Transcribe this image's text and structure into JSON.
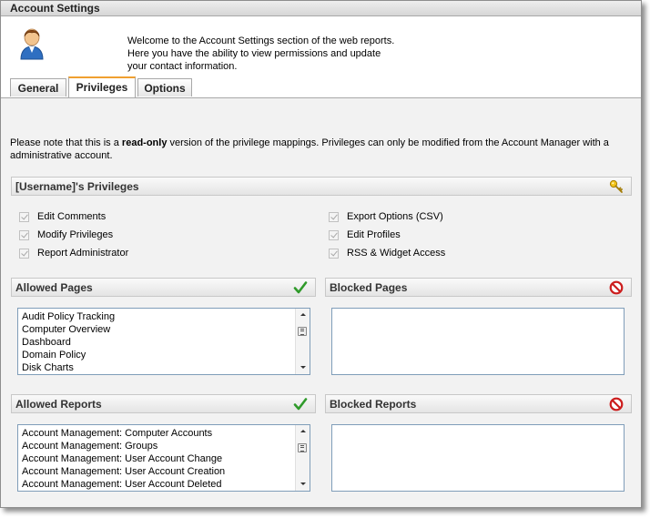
{
  "window": {
    "title": "Account Settings"
  },
  "header": {
    "avatar_icon": "user-avatar-icon",
    "welcome_line1": "Welcome to the Account Settings section of the web reports.",
    "welcome_line2": "Here you have the ability to view permissions and update",
    "welcome_line3": "your contact information."
  },
  "tabs": [
    {
      "label": "General",
      "active": false
    },
    {
      "label": "Privileges",
      "active": true
    },
    {
      "label": "Options",
      "active": false
    }
  ],
  "note": {
    "prefix": "Please note that this is a ",
    "bold": "read-only",
    "suffix": " version of the privilege mappings. Privileges can only be modified from the Account Manager with a administrative account."
  },
  "privileges": {
    "title": "[Username]'s Privileges",
    "icon": "key-icon",
    "left": [
      {
        "label": "Edit Comments",
        "checked": true
      },
      {
        "label": "Modify Privileges",
        "checked": true
      },
      {
        "label": "Report Administrator",
        "checked": true
      }
    ],
    "right": [
      {
        "label": "Export Options (CSV)",
        "checked": true
      },
      {
        "label": "Edit Profiles",
        "checked": true
      },
      {
        "label": "RSS & Widget Access",
        "checked": true
      }
    ]
  },
  "allowed_pages": {
    "title": "Allowed Pages",
    "icon": "checkmark-icon",
    "items": [
      "Audit Policy Tracking",
      "Computer Overview",
      "Dashboard",
      "Domain Policy",
      "Disk Charts"
    ]
  },
  "blocked_pages": {
    "title": "Blocked Pages",
    "icon": "blocked-icon",
    "items": []
  },
  "allowed_reports": {
    "title": "Allowed Reports",
    "icon": "checkmark-icon",
    "items": [
      "Account Management: Computer Accounts",
      "Account Management: Groups",
      "Account Management: User Account Change",
      "Account Management: User Account Creation",
      "Account Management: User Account Deleted"
    ]
  },
  "blocked_reports": {
    "title": "Blocked Reports",
    "icon": "blocked-icon",
    "items": []
  }
}
